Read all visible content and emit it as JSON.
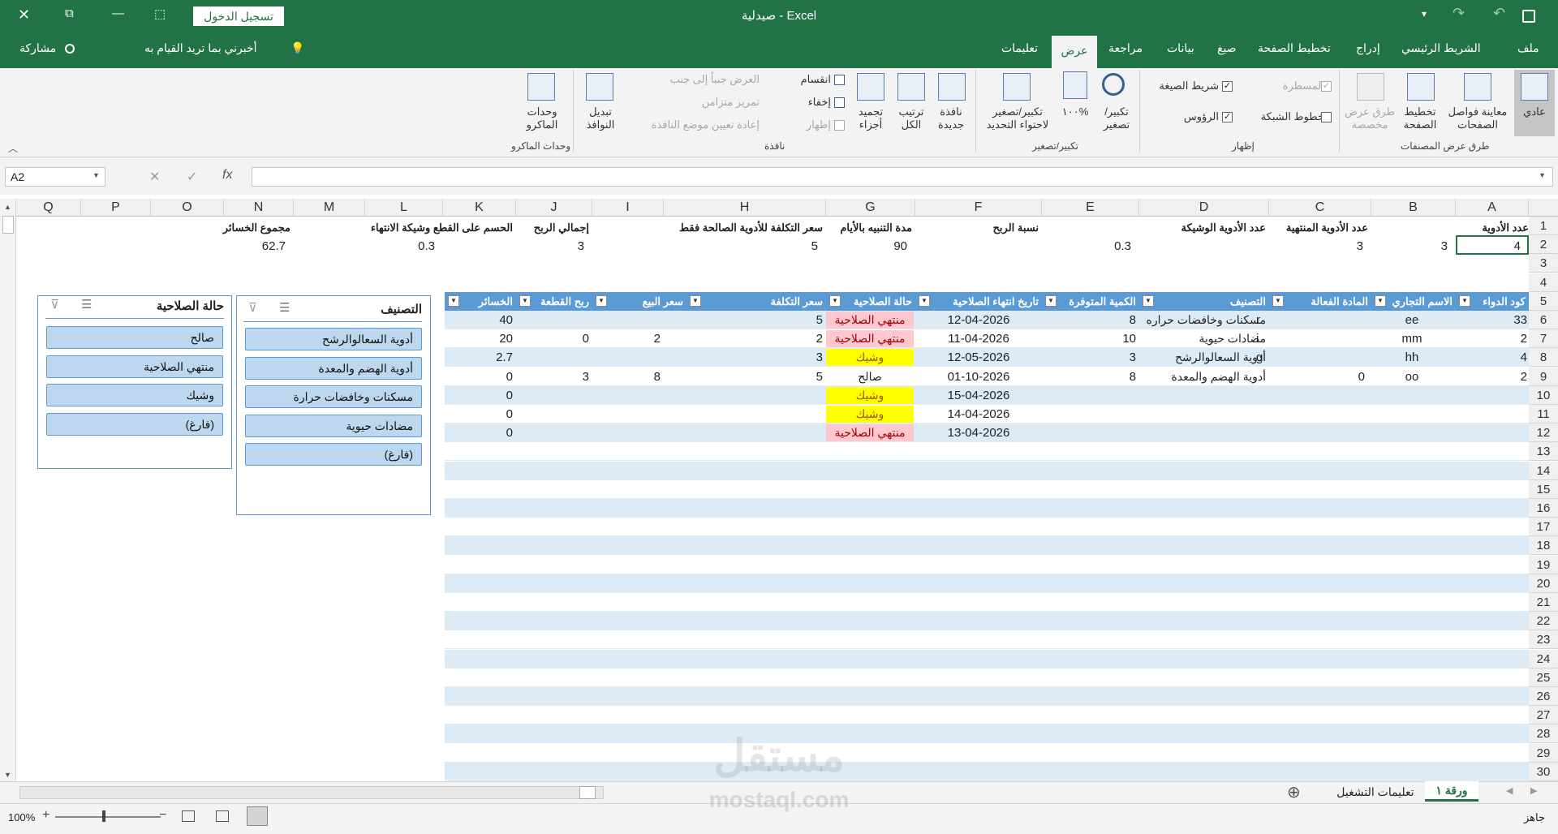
{
  "title_bar": {
    "title": "صيدلية  -  Excel",
    "login_button": "تسجيل الدخول",
    "close": "✕",
    "restore": "⧉",
    "minimize": "—",
    "ribbon_display": "⬚",
    "save": "💾",
    "undo": "↶",
    "redo": "↷",
    "customize": "▾"
  },
  "tabs": {
    "file": "ملف",
    "home": "الشريط الرئيسي",
    "insert": "إدراج",
    "page_layout": "تخطيط الصفحة",
    "formulas": "صيغ",
    "data": "بيانات",
    "review": "مراجعة",
    "view": "عرض",
    "help": "تعليمات",
    "tell_me": "أخبرني بما تريد القيام به",
    "share": "مشاركة"
  },
  "ribbon": {
    "workbook_views": {
      "group": "طرق عرض المصنفات",
      "normal": "عادي",
      "page_break": "معاينة فواصل الصفحات",
      "page_layout": "تخطيط الصفحة",
      "custom": "طرق عرض مخصصة"
    },
    "show": {
      "group": "إظهار",
      "ruler": "المسطرة",
      "formula_bar": "شريط الصيغة",
      "gridlines": "خطوط الشبكة",
      "headings": "الرؤوس"
    },
    "zoom": {
      "group": "تكبير/تصغير",
      "zoom": "تكبير/تصغير",
      "hundred": "١٠٠%",
      "zoom_selection": "تكبير/تصغير لاحتواء التحديد"
    },
    "window": {
      "group": "نافذة",
      "new_window": "نافذة جديدة",
      "arrange_all": "ترتيب الكل",
      "freeze": "تجميد أجزاء",
      "split": "انقسام",
      "hide": "إخفاء",
      "unhide": "إظهار",
      "side_by_side": "العرض جنباً إلى جنب",
      "sync_scroll": "تمرير متزامن",
      "reset_pos": "إعادة تعيين موضع النافذة",
      "switch": "تبديل النوافذ"
    },
    "macros": {
      "group": "وحدات الماكرو",
      "macros": "وحدات الماكرو"
    }
  },
  "formula_bar": {
    "name_box": "A2",
    "fx": "fx",
    "value": ""
  },
  "columns": [
    "A",
    "B",
    "C",
    "D",
    "E",
    "F",
    "G",
    "H",
    "I",
    "J",
    "K",
    "L",
    "M",
    "N",
    "O",
    "P",
    "Q"
  ],
  "rows": [
    "1",
    "2",
    "3",
    "4",
    "5",
    "6",
    "7",
    "8",
    "9",
    "10",
    "11",
    "12",
    "13",
    "14",
    "15",
    "16",
    "17",
    "18",
    "19",
    "20",
    "21",
    "22",
    "23",
    "24",
    "25",
    "26",
    "27",
    "28",
    "29",
    "30"
  ],
  "summary": {
    "labels": [
      "عدد الأدوية",
      "عدد الأدوية المنتهية",
      "عدد الأدوية الوشيكة",
      "نسبة الربح",
      "مدة التنبيه بالأيام",
      "سعر التكلفة للأدوية الصالحة فقط",
      "إجمالي الربح",
      "الحسم على القطع وشيكة الانتهاء",
      "مجموع الخسائر"
    ],
    "values": [
      "4",
      "3",
      "3",
      "0.3",
      "90",
      "5",
      "3",
      "0.3",
      "62.7"
    ]
  },
  "table": {
    "headers": [
      "كود الدواء",
      "الاسم التجاري",
      "المادة الفعالة",
      "التصنيف",
      "الكمية المتوفرة",
      "تاريخ انتهاء الصلاحية",
      "حالة الصلاحية",
      "سعر التكلفة",
      "سعر البيع",
      "ربح القطعة",
      "الخسائر"
    ],
    "rows": [
      {
        "code": "33",
        "trade": "ee",
        "active": "",
        "class_code": "r",
        "class": "مسكنات وخافضات حراره",
        "qty": "8",
        "expiry": "12-04-2026",
        "status": "منتهي الصلاحية",
        "cost": "5",
        "price": "",
        "profit": "",
        "loss": "40"
      },
      {
        "code": "2",
        "trade": "mm",
        "active": "",
        "class_code": "i",
        "class": "مضادات حيوية",
        "qty": "10",
        "expiry": "11-04-2026",
        "status": "منتهي الصلاحية",
        "cost": "2",
        "price": "2",
        "profit": "0",
        "loss": "20"
      },
      {
        "code": "4",
        "trade": "hh",
        "active": "",
        "class_code": "g",
        "class": "أدوية السعالوالرشح",
        "qty": "3",
        "expiry": "12-05-2026",
        "status": "وشيك",
        "cost": "3",
        "price": "",
        "profit": "",
        "loss": "2.7"
      },
      {
        "code": "2",
        "trade": "oo",
        "active": "0",
        "class_code": "",
        "class": "أدوية الهضم والمعدة",
        "qty": "8",
        "expiry": "01-10-2026",
        "status": "صالح",
        "cost": "5",
        "price": "8",
        "profit": "3",
        "loss": "0"
      },
      {
        "code": "",
        "trade": "",
        "active": "",
        "class_code": "",
        "class": "",
        "qty": "",
        "expiry": "15-04-2026",
        "status": "وشيك",
        "cost": "",
        "price": "",
        "profit": "",
        "loss": "0"
      },
      {
        "code": "",
        "trade": "",
        "active": "",
        "class_code": "",
        "class": "",
        "qty": "",
        "expiry": "14-04-2026",
        "status": "وشيك",
        "cost": "",
        "price": "",
        "profit": "",
        "loss": "0"
      },
      {
        "code": "",
        "trade": "",
        "active": "",
        "class_code": "",
        "class": "",
        "qty": "",
        "expiry": "13-04-2026",
        "status": "منتهي الصلاحية",
        "cost": "",
        "price": "",
        "profit": "",
        "loss": "0"
      }
    ]
  },
  "slicers": {
    "classification": {
      "title": "التصنيف",
      "items": [
        "أدوية السعالوالرشح",
        "أدوية الهضم والمعدة",
        "مسكنات وخافضات حرارة",
        "مضادات حيوية",
        "(فارغ)"
      ]
    },
    "validity": {
      "title": "حالة الصلاحية",
      "items": [
        "صالح",
        "منتهي الصلاحية",
        "وشيك",
        "(فارغ)"
      ]
    }
  },
  "sheets": {
    "active": "ورقة ١",
    "other": "تعليمات التشغيل",
    "add": "⊕"
  },
  "status": {
    "ready": "جاهز",
    "zoom": "100%"
  },
  "watermark": {
    "ar": "مستقل",
    "en": "mostaql.com"
  },
  "colors": {
    "excel_green": "#217346",
    "table_header": "#5b9bd5",
    "band": "#ddebf7",
    "expired_fill": "#ffc7ce",
    "expired_text": "#9c0006",
    "near_fill": "#ffff00",
    "near_text": "#9c5700"
  }
}
